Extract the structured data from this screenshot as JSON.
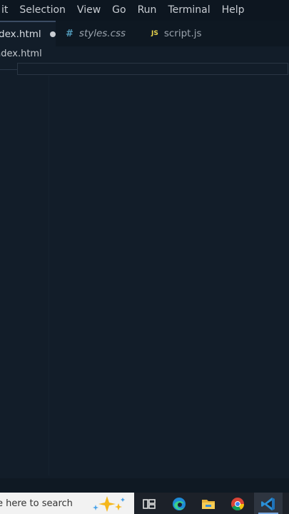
{
  "menubar": {
    "items": [
      "it",
      "Selection",
      "View",
      "Go",
      "Run",
      "Terminal",
      "Help"
    ]
  },
  "tabs": [
    {
      "label": "dex.html",
      "modified": true
    },
    {
      "label": "styles.css",
      "icon": "#"
    },
    {
      "label": "script.js",
      "icon": "JS"
    }
  ],
  "breadcrumb": {
    "file": "ndex.html"
  },
  "taskbar": {
    "search_placeholder": "e here to search",
    "icons": [
      "task-view-icon",
      "edge-icon",
      "file-explorer-icon",
      "chrome-icon",
      "vscode-icon"
    ]
  },
  "colors": {
    "editor_bg": "#121d29",
    "menubar_bg": "#0d1620",
    "taskbar_bg": "#1c2129",
    "css_icon": "#519aba",
    "js_icon": "#e8d44d"
  }
}
